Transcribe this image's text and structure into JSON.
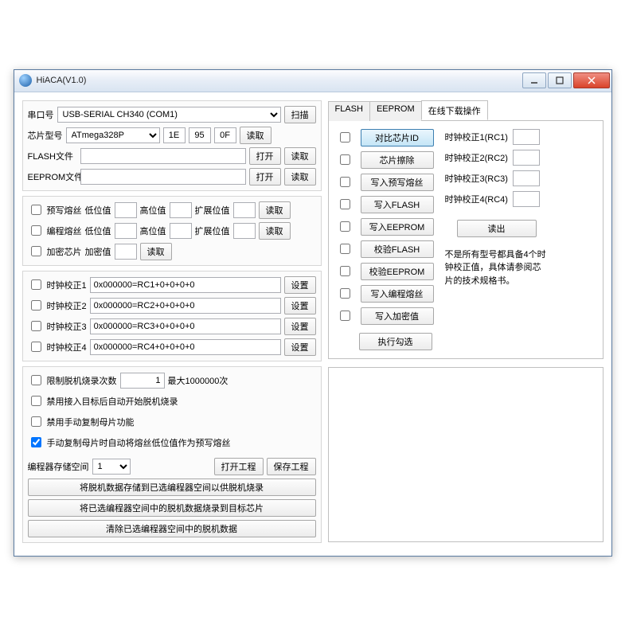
{
  "window": {
    "title": "HiACA(V1.0)"
  },
  "top": {
    "port_label": "串口号",
    "port_value": "USB-SERIAL CH340 (COM1)",
    "scan_btn": "扫描",
    "chip_label": "芯片型号",
    "chip_value": "ATmega328P",
    "sig1": "1E",
    "sig2": "95",
    "sig3": "0F",
    "read_btn": "读取",
    "flash_label": "FLASH文件",
    "open_btn": "打开",
    "eeprom_label": "EEPROM文件"
  },
  "fuses": {
    "prewrite": "预写熔丝",
    "program": "编程熔丝",
    "lock": "加密芯片",
    "low": "低位值",
    "high": "高位值",
    "ext": "扩展位值",
    "lockval": "加密值",
    "read": "读取"
  },
  "clock": {
    "items": [
      {
        "label": "时钟校正1",
        "value": "0x000000=RC1+0+0+0+0"
      },
      {
        "label": "时钟校正2",
        "value": "0x000000=RC2+0+0+0+0"
      },
      {
        "label": "时钟校正3",
        "value": "0x000000=RC3+0+0+0+0"
      },
      {
        "label": "时钟校正4",
        "value": "0x000000=RC4+0+0+0+0"
      }
    ],
    "set_btn": "设置"
  },
  "offline": {
    "limit_label": "限制脱机烧录次数",
    "limit_value": "1",
    "limit_suffix": "最大1000000次",
    "opt1": "禁用接入目标后自动开始脱机烧录",
    "opt2": "禁用手动复制母片功能",
    "opt3": "手动复制母片时自动将熔丝低位值作为预写熔丝",
    "space_label": "编程器存储空间",
    "space_value": "1",
    "open_proj": "打开工程",
    "save_proj": "保存工程",
    "btn1": "将脱机数据存储到已选编程器空间以供脱机烧录",
    "btn2": "将已选编程器空间中的脱机数据烧录到目标芯片",
    "btn3": "清除已选编程器空间中的脱机数据"
  },
  "tabs": {
    "flash": "FLASH",
    "eeprom": "EEPROM",
    "online": "在线下载操作"
  },
  "ops": [
    "对比芯片ID",
    "芯片擦除",
    "写入预写熔丝",
    "写入FLASH",
    "写入EEPROM",
    "校验FLASH",
    "校验EEPROM",
    "写入编程熔丝",
    "写入加密值"
  ],
  "execute": "执行勾选",
  "rc": {
    "items": [
      "时钟校正1(RC1)",
      "时钟校正2(RC2)",
      "时钟校正3(RC3)",
      "时钟校正4(RC4)"
    ],
    "read_btn": "读出",
    "note": "不是所有型号都具备4个时钟校正值，具体请参阅芯片的技术规格书。"
  }
}
